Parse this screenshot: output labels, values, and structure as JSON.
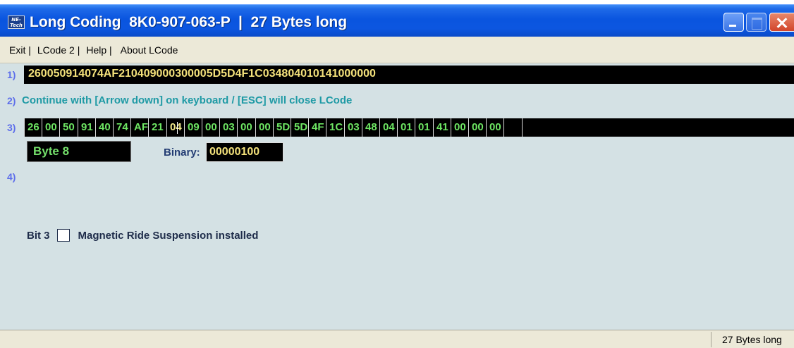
{
  "window": {
    "logo_text": "NE-Tech",
    "title": "Long Coding  8K0-907-063-P  |  27 Bytes long"
  },
  "menu": [
    {
      "label": "Exit |"
    },
    {
      "label": "LCode 2 |"
    },
    {
      "label": "Help |"
    },
    {
      "label": "About LCode"
    }
  ],
  "rows": {
    "r1_label": "1)",
    "r1_value": "260050914074AF210409000300005D5D4F1C034804010141000000",
    "r2_label": "2)",
    "r2_message": "Continue with [Arrow down] on keyboard / [ESC] will close LCode",
    "r3_label": "3)",
    "r4_label": "4)"
  },
  "bytes": [
    "26",
    "00",
    "50",
    "91",
    "40",
    "74",
    "AF",
    "21",
    "04",
    "09",
    "00",
    "03",
    "00",
    "00",
    "5D",
    "5D",
    "4F",
    "1C",
    "03",
    "48",
    "04",
    "01",
    "01",
    "41",
    "00",
    "00",
    "00",
    "",
    ""
  ],
  "selected_byte_index": 8,
  "byte_info": {
    "byte_label": "Byte 8",
    "binary_label": "Binary:",
    "binary_value": "00000100"
  },
  "bit": {
    "label": "Bit 3",
    "checked": false,
    "description": "Magnetic Ride Suspension installed"
  },
  "status": {
    "text": "27 Bytes long"
  },
  "colors": {
    "titlebar": "#0a55df",
    "client_bg": "#d4e1e4",
    "byte_green": "#6ee663",
    "value_yellow": "#f4e27b",
    "message_teal": "#1f9aa5"
  }
}
